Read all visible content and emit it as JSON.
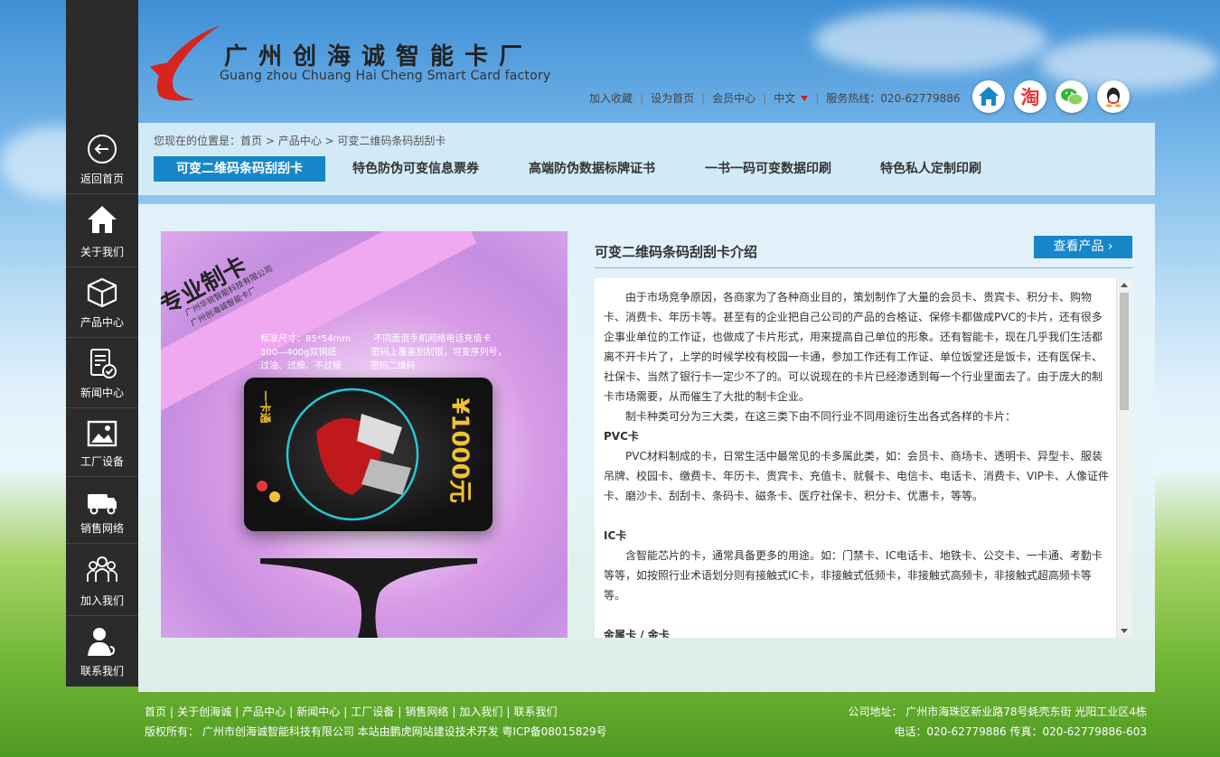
{
  "header": {
    "logo_cn": "广州创海诚智能卡厂",
    "logo_en": "Guang zhou Chuang Hai Cheng Smart Card factory",
    "links": [
      "加入收藏",
      "设为首页",
      "会员中心",
      "中文"
    ],
    "hotline": "服务热线：020-62779886",
    "social": [
      {
        "name": "home-icon",
        "glyph": "⌂",
        "color": "#1786c9"
      },
      {
        "name": "taobao-icon",
        "glyph": "淘",
        "color": "#e4393c"
      },
      {
        "name": "wechat-icon",
        "glyph": "◕",
        "color": "#35b534"
      },
      {
        "name": "qq-icon",
        "glyph": "☻",
        "color": "#222222"
      }
    ]
  },
  "sidebar": {
    "items": [
      {
        "label": "返回首页",
        "icon": "back-arrow-icon"
      },
      {
        "label": "关于我们",
        "icon": "home-icon"
      },
      {
        "label": "产品中心",
        "icon": "box-icon"
      },
      {
        "label": "新闻中心",
        "icon": "news-icon"
      },
      {
        "label": "工厂设备",
        "icon": "picture-icon"
      },
      {
        "label": "销售网络",
        "icon": "truck-icon"
      },
      {
        "label": "加入我们",
        "icon": "group-icon"
      },
      {
        "label": "联系我们",
        "icon": "contact-icon"
      }
    ]
  },
  "breadcrumb": {
    "prefix": "您现在的位置是：",
    "items": [
      "首页",
      "产品中心",
      "可变二维码条码刮刮卡"
    ]
  },
  "tabs": [
    {
      "label": "可变二维码条码刮刮卡",
      "active": true
    },
    {
      "label": "特色防伪可变信息票券",
      "active": false
    },
    {
      "label": "高端防伪数据标牌证书",
      "active": false
    },
    {
      "label": "一书一码可变数据印刷",
      "active": false
    },
    {
      "label": "特色私人定制印刷",
      "active": false
    }
  ],
  "promo": {
    "banner": "专业制卡",
    "company_lines": [
      "广州华锐智能科技有限公司",
      "Guangzhou Hua Ri Intelligent Technology Co., LTD",
      "广州创海诚智能卡厂",
      "Guang zhou Chuang Hai Cheng Smart Card factory"
    ],
    "specs": "标准尺寸：85*54mm        不同面值手机网络电话充值卡\n300—400g双铜纸            密码上覆盖刮刮银，可变序列号，\n过油、过膜、不过膜          密码二维码",
    "card_value": "¥1000元",
    "card_brand": "一卡通"
  },
  "intro": {
    "title": "可变二维码条码刮刮卡介绍",
    "button": "查看产品",
    "paragraphs": [
      {
        "type": "p",
        "text": "由于市场竞争原因，各商家为了各种商业目的，策划制作了大量的会员卡、贵宾卡、积分卡、购物卡、消费卡、年历卡等。甚至有的企业把自己公司的产品的合格证、保修卡都做成PVC的卡片，还有很多企事业单位的工作证，也做成了卡片形式，用来提高自己单位的形象。还有智能卡，现在几乎我们生活都离不开卡片了，上学的时候学校有校园一卡通，参加工作还有工作证、单位饭堂还是饭卡，还有医保卡、社保卡、当然了银行卡一定少不了的。可以说现在的卡片已经渗透到每一个行业里面去了。由于庞大的制卡市场需要，从而催生了大批的制卡企业。"
      },
      {
        "type": "p",
        "text": "制卡种类可分为三大类，在这三类下由不同行业不同用途衍生出各式各样的卡片："
      },
      {
        "type": "h",
        "text": "PVC卡"
      },
      {
        "type": "p",
        "text": "PVC材料制成的卡，日常生活中最常见的卡多属此类，如：会员卡、商场卡、透明卡、异型卡、服装吊牌、校园卡、缴费卡、年历卡、贵宾卡、充值卡、就餐卡、电信卡、电话卡、消费卡、VIP卡、人像证件卡、磨沙卡、刮刮卡、条码卡、磁条卡、医疗社保卡、积分卡、优惠卡，等等。"
      },
      {
        "type": "gap",
        "text": ""
      },
      {
        "type": "h",
        "text": "IC卡"
      },
      {
        "type": "p",
        "text": "含智能芯片的卡，通常具备更多的用途。如：门禁卡、IC电话卡、地铁卡、公交卡、一卡通、考勤卡等等，如按照行业术语划分则有接触式IC卡，非接触式低频卡，非接触式高频卡，非接触式超高频卡等等。"
      },
      {
        "type": "gap",
        "text": ""
      },
      {
        "type": "h",
        "text": "金属卡 / 金卡"
      }
    ]
  },
  "footer": {
    "links": [
      "首页",
      "关于创海诚",
      "产品中心",
      "新闻中心",
      "工厂设备",
      "销售网络",
      "加入我们",
      "联系我们"
    ],
    "copyright": "版权所有：  广州市创海诚智能科技有限公司 本站由鹏虎网站建设技术开发 粤ICP备08015829号",
    "address": "公司地址：  广州市海珠区新业路78号蚝壳东街 光阳工业区4栋",
    "phone": "电话：020-62779886 传真：020-62779886-603"
  }
}
